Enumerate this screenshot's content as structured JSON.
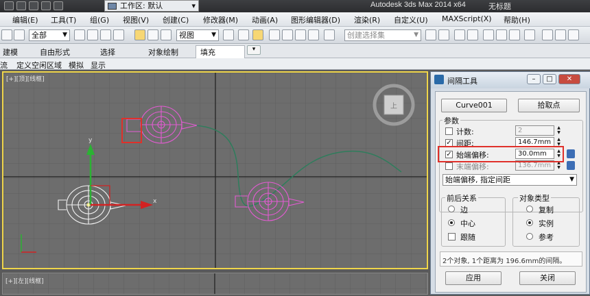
{
  "titlebar": {
    "workspace": "工作区: 默认",
    "app_title": "Autodesk 3ds Max  2014 x64",
    "doc_title": "无标题"
  },
  "menu": [
    "编辑(E)",
    "工具(T)",
    "组(G)",
    "视图(V)",
    "创建(C)",
    "修改器(M)",
    "动画(A)",
    "图形编辑器(D)",
    "渲染(R)",
    "自定义(U)",
    "MAXScript(X)",
    "帮助(H)"
  ],
  "toolbar": {
    "filter": "全部",
    "coord": "视图",
    "named_sel_placeholder": "创建选择集"
  },
  "ribbon": {
    "tabs": [
      "建模",
      "自由形式",
      "选择",
      "对象绘制",
      "填充"
    ]
  },
  "subribbon": [
    "流",
    "定义空闲区域",
    "模拟",
    "显示"
  ],
  "viewport": {
    "label": "[+][顶][线框]",
    "bottom_label": "[+][左][线框]",
    "axis_x": "x",
    "axis_y": "y",
    "gizmo_letter": "上"
  },
  "dialog": {
    "title": "间隔工具",
    "curve_button": "Curve001",
    "pick_button": "拾取点",
    "params_label": "参数",
    "count_label": "计数:",
    "count_value": "2",
    "spacing_label": "间距:",
    "spacing_value": "146.7mm",
    "start_offset_label": "始端偏移:",
    "start_offset_value": "30.0mm",
    "end_offset_label": "末端偏移:",
    "end_offset_value": "136.7mm",
    "mode_value": "始端偏移, 指定间距",
    "context_group": "前后关系",
    "ctx_edge": "边",
    "ctx_center": "中心",
    "ctx_follow": "跟随",
    "type_group": "对象类型",
    "type_copy": "复制",
    "type_instance": "实例",
    "type_reference": "参考",
    "status": "2个对象, 1个距离为 196.6mm的间隔。",
    "apply_button": "应用",
    "close_button": "关闭"
  }
}
